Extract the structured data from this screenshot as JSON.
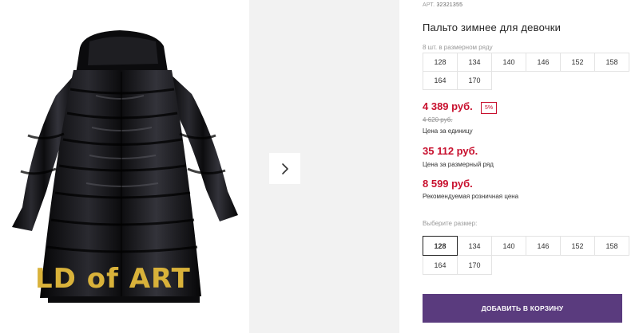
{
  "product": {
    "article_prefix": "АРТ.",
    "article": "32321355",
    "title": "Пальто зимнее для девочки",
    "print_text": "LD of ART"
  },
  "pack": {
    "note": "8 шт. в размерном ряду",
    "sizes": [
      "128",
      "134",
      "140",
      "146",
      "152",
      "158",
      "164",
      "170"
    ]
  },
  "prices": {
    "unit_price": "4 389 руб.",
    "discount": "5%",
    "old_price": "4 620 руб.",
    "unit_label": "Цена за единицу",
    "set_price": "35 112 руб.",
    "set_label": "Цена за размерный ряд",
    "rrp_price": "8 599 руб.",
    "rrp_label": "Рекомендуемая розничная цена"
  },
  "size_select": {
    "label": "Выберите размер:",
    "selected": "128",
    "sizes": [
      "128",
      "134",
      "140",
      "146",
      "152",
      "158",
      "164",
      "170"
    ]
  },
  "actions": {
    "add_to_cart": "ДОБАВИТЬ В КОРЗИНУ"
  },
  "icons": {
    "next": "chevron-right-icon"
  },
  "colors": {
    "price": "#c8102e",
    "button": "#5a3b7e",
    "coat": "#0b0b0d",
    "print": "#d9b23a"
  }
}
